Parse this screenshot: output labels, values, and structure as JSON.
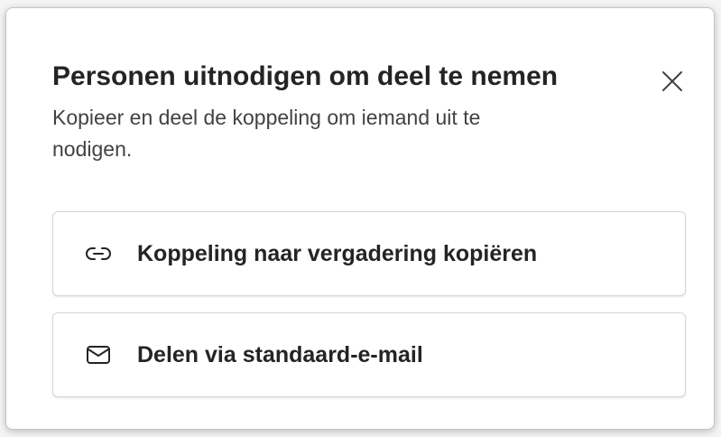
{
  "dialog": {
    "title": "Personen uitnodigen om deel te nemen",
    "subtitle": "Kopieer en deel de koppeling om iemand uit te nodigen.",
    "close_icon": "close-icon"
  },
  "options": [
    {
      "label": "Koppeling naar vergadering kopiëren",
      "icon": "link-icon"
    },
    {
      "label": "Delen via standaard-e-mail",
      "icon": "mail-icon"
    }
  ],
  "colors": {
    "text": "#242424",
    "subtext": "#424242",
    "border": "#d6d6d6",
    "background": "#ffffff"
  }
}
